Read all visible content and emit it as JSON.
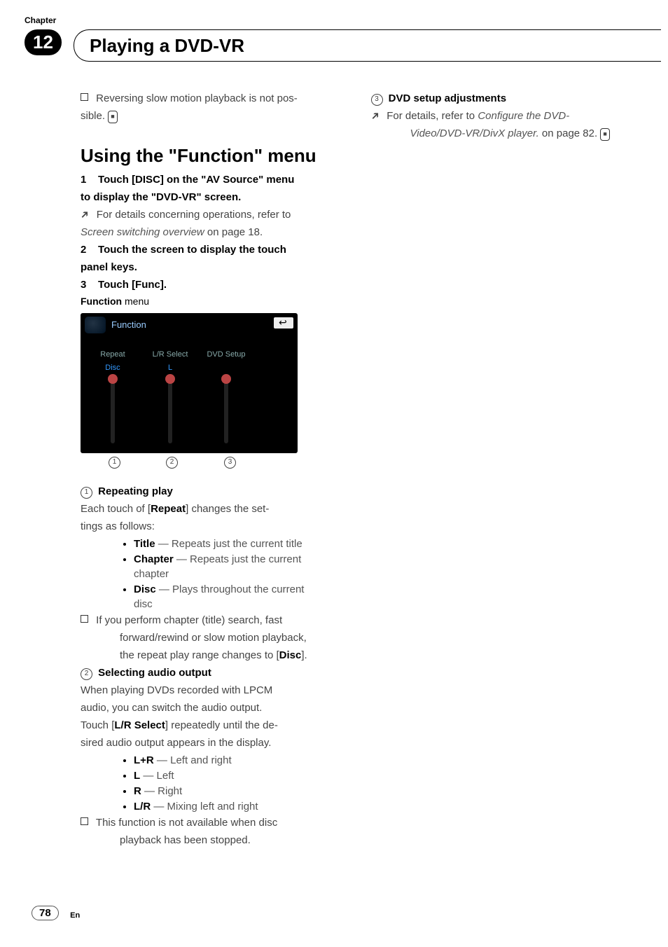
{
  "chapter_label": "Chapter",
  "chapter_number": "12",
  "page_title": "Playing a DVD-VR",
  "left": {
    "note1_a": "Reversing slow motion playback is not pos-",
    "note1_b": "sible.",
    "h2": "Using the \"Function\" menu",
    "step1_pre": "1",
    "step1_a": "Touch [DISC] on the \"AV Source\" menu",
    "step1_b": "to display the \"DVD-VR\" screen.",
    "step1_ref_a": "For details concerning operations, refer to",
    "step1_ref_b": "Screen switching overview",
    "step1_ref_c": " on page 18.",
    "step2_pre": "2",
    "step2_a": "Touch the screen to display the touch",
    "step2_b": "panel keys.",
    "step3_pre": "3",
    "step3_a": "Touch [Func].",
    "menu_label_a": "Function",
    "menu_label_b": " menu",
    "screenshot": {
      "title": "Function",
      "col1_label": "Repeat",
      "col1_value": "Disc",
      "col2_label": "L/R Select",
      "col2_value": "L",
      "col3_label": "DVD Setup"
    },
    "callout1": "1",
    "callout2": "2",
    "callout3": "3",
    "item1_head": "Repeating play",
    "item1_a": "Each touch of [",
    "item1_a_strong": "Repeat",
    "item1_b": "] changes the set-",
    "item1_c": "tings as follows:",
    "i1_li1_strong": "Title",
    "i1_li1_rest": " — Repeats just the current title",
    "i1_li2_strong": "Chapter",
    "i1_li2_rest_a": " — Repeats just the current",
    "i1_li2_rest_b": "chapter",
    "i1_li3_strong": "Disc",
    "i1_li3_rest_a": " — Plays throughout the current",
    "i1_li3_rest_b": "disc",
    "i1_note_a": "If you perform chapter (title) search, fast",
    "i1_note_b": "forward/rewind or slow motion playback,",
    "i1_note_c": "the repeat play range changes to [",
    "i1_note_c_strong": "Disc",
    "i1_note_d": "].",
    "item2_head": "Selecting audio output",
    "i2_a": "When playing DVDs recorded with LPCM",
    "i2_b": "audio, you can switch the audio output.",
    "i2_c": "Touch [",
    "i2_c_strong": "L/R Select",
    "i2_d": "] repeatedly until the de-",
    "i2_e": "sired audio output appears in the display.",
    "i2_li1_strong": "L+R",
    "i2_li1_rest": " — Left and right",
    "i2_li2_strong": "L",
    "i2_li2_rest": " — Left",
    "i2_li3_strong": "R",
    "i2_li3_rest": " — Right",
    "i2_li4_strong": "L/R",
    "i2_li4_rest": " — Mixing left and right",
    "i2_note_a": "This function is not available when disc",
    "i2_note_b": "playback has been stopped."
  },
  "right": {
    "item3_head": "DVD setup adjustments",
    "ref_a": "For details, refer to ",
    "ref_b": "Configure the DVD-",
    "ref_c": "Video/DVD-VR/DivX player.",
    "ref_d": " on page 82."
  },
  "page_number": "78",
  "page_lang": "En"
}
